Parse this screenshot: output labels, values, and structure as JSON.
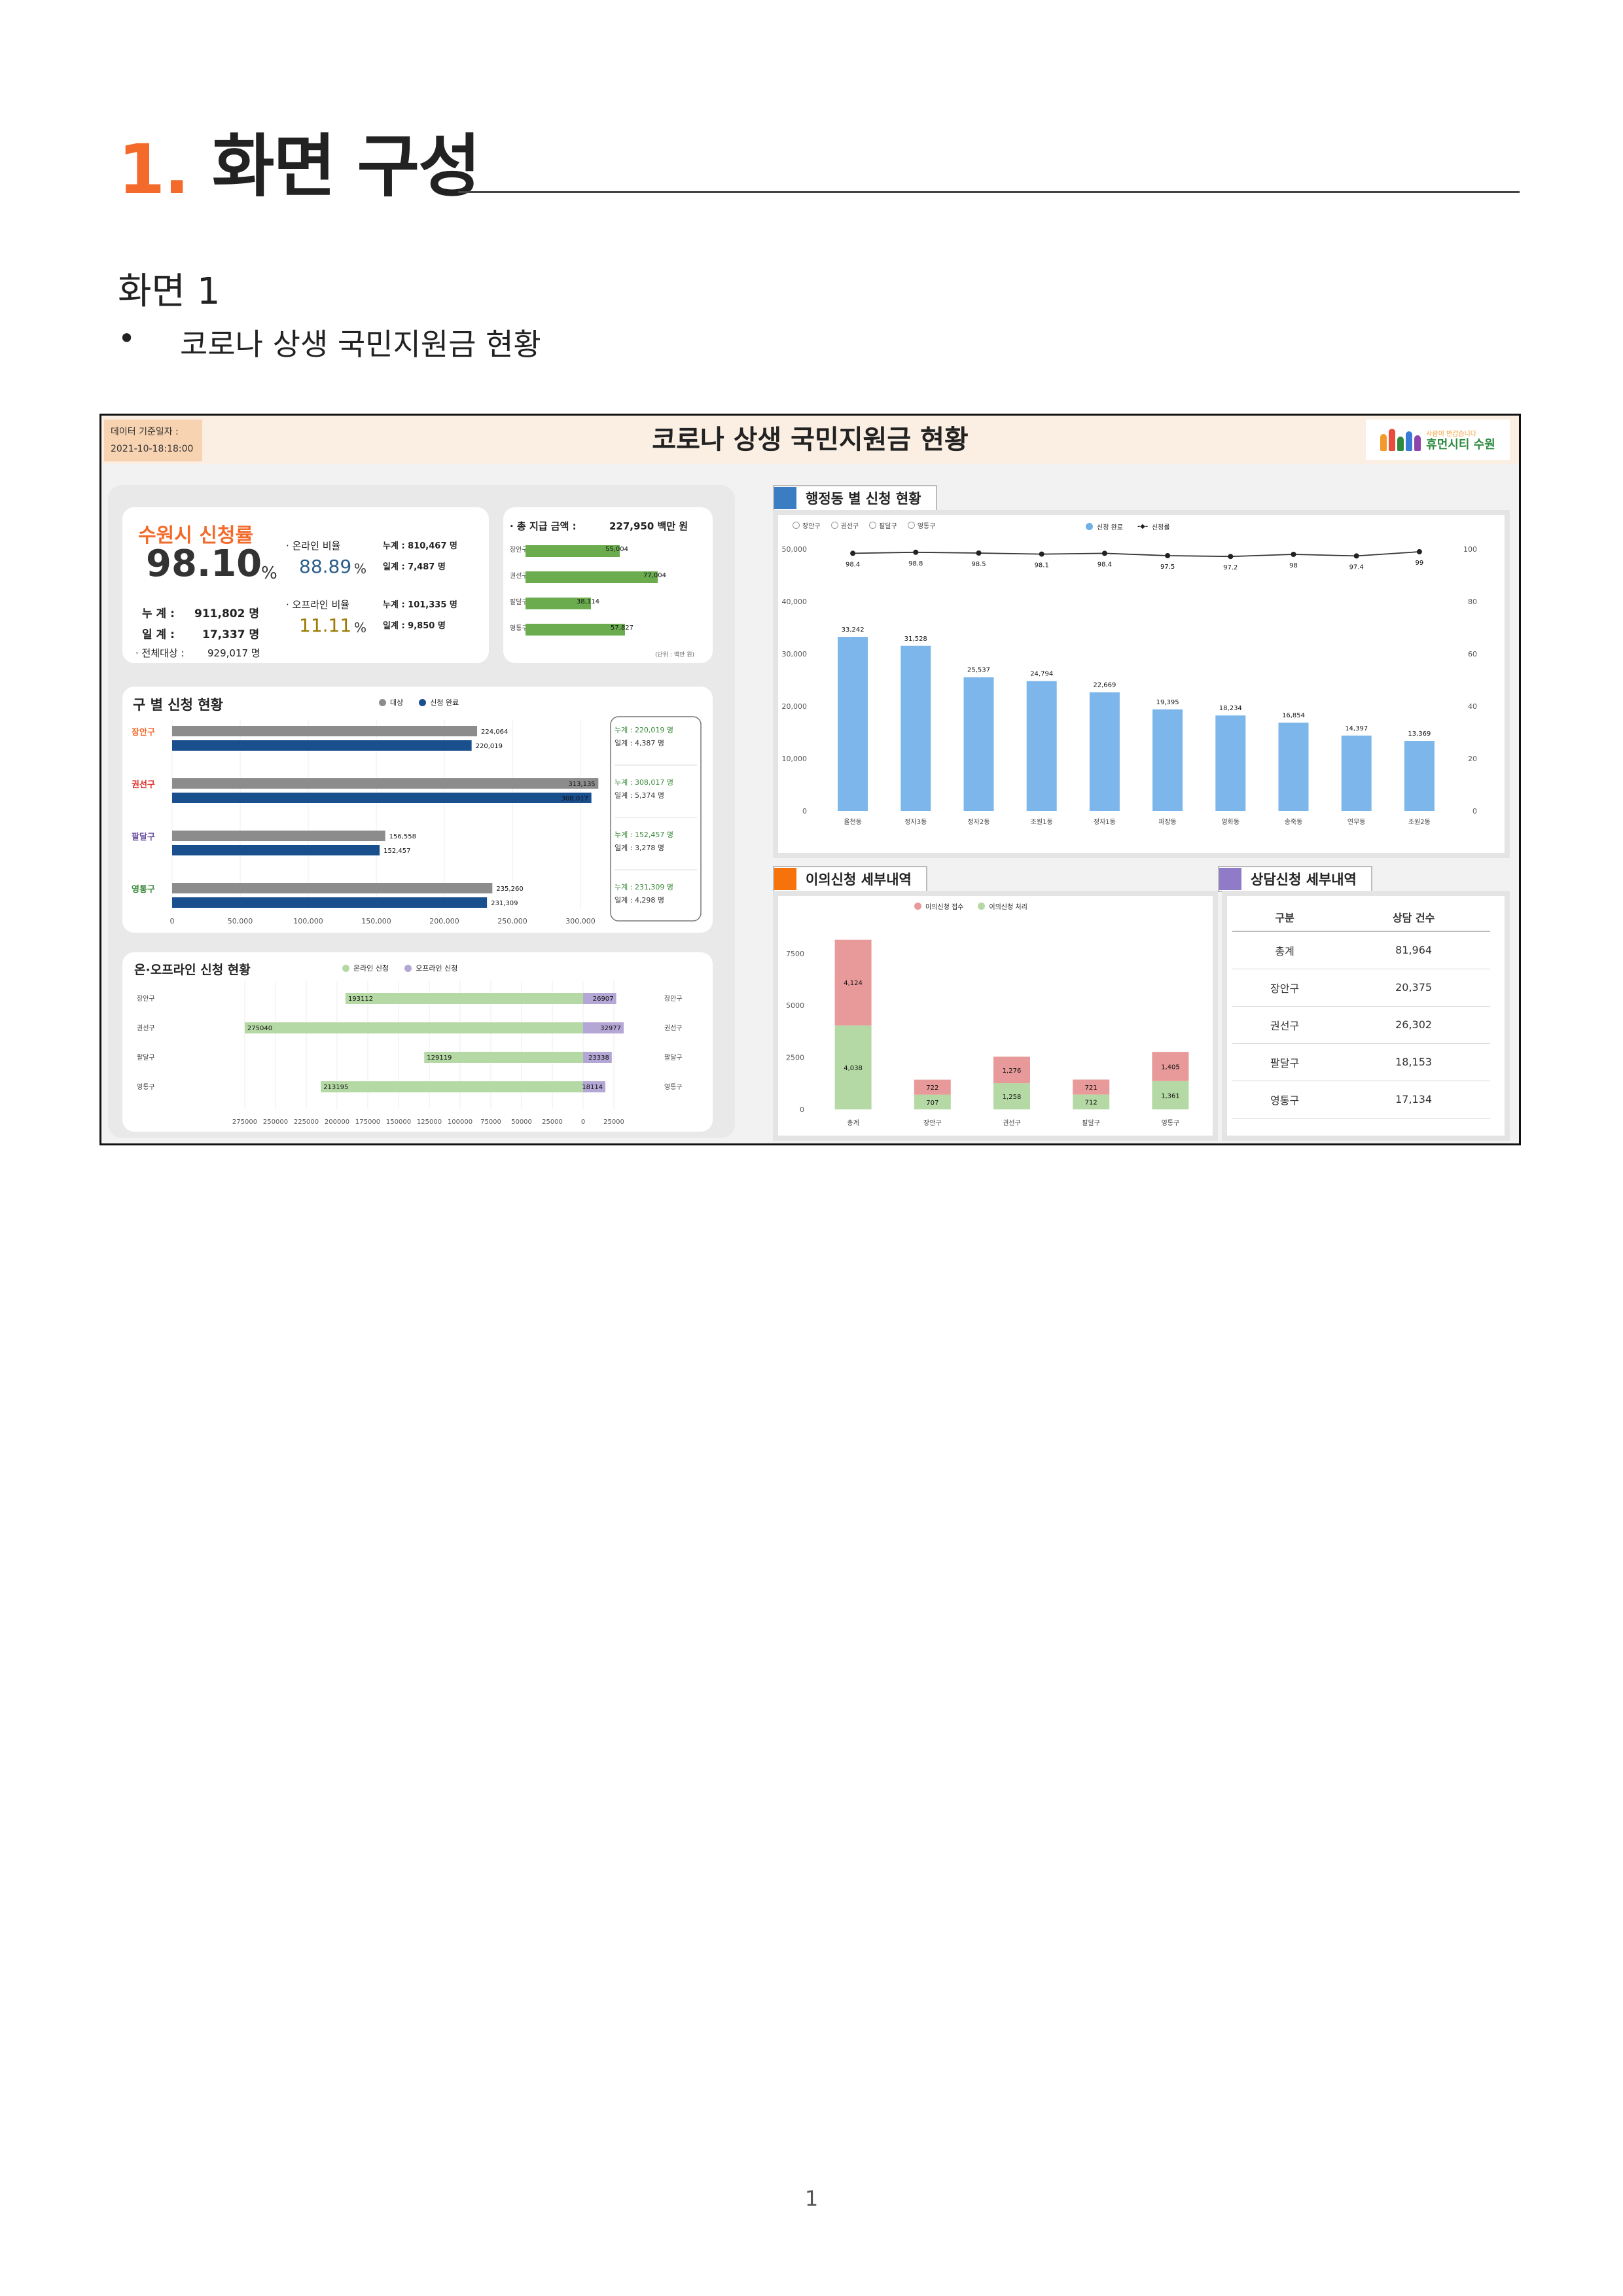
{
  "doc": {
    "title_number": "1.",
    "title": "화면 구성",
    "subtitle": "화면 1",
    "bullet_mark": "•",
    "bullet_text": "코로나 상생 국민지원금 현황",
    "page_number": "1"
  },
  "dashboard": {
    "date_label": "데이터 기준일자 :",
    "date_value": "2021-10-18:18:00",
    "title": "코로나 상생 국민지원금 현황",
    "logo_small": "사람이 반갑습니다",
    "logo_main": "휴먼시티 수원",
    "rate_card": {
      "title": "수원시 신청률",
      "rate": "98.10",
      "rate_unit": "%",
      "cum_label": "누  계 :",
      "cum_value": "911,802 명",
      "day_label": "일  계 :",
      "day_value": "17,337 명",
      "total_label": "· 전체대상 :",
      "total_value": "929,017 명",
      "online_label": "· 온라인 비율",
      "online_rate": "88.89",
      "online_cum": "누계 :  810,467 명",
      "online_day": "일계 :    7,487 명",
      "offline_label": "· 오프라인 비율",
      "offline_rate": "11.11",
      "offline_cum": "누계 :  101,335 명",
      "offline_day": "일계 :    9,850 명",
      "pct": "%"
    },
    "pay_card": {
      "title": "· 총 지급 금액 :",
      "amount": "227,950 백만 원",
      "unit_note": "(단위 : 백만 원)",
      "rows": [
        {
          "name": "장안구",
          "value": 55004,
          "label": "55,004"
        },
        {
          "name": "권선구",
          "value": 77004,
          "label": "77,004"
        },
        {
          "name": "팔달구",
          "value": 38114,
          "label": "38,114"
        },
        {
          "name": "영통구",
          "value": 57827,
          "label": "57,827"
        }
      ]
    },
    "gu_card": {
      "title": "구 별 신청 현황",
      "legend_target": "대상",
      "legend_done": "신청 완료",
      "axis_ticks": [
        "0",
        "50,000",
        "100,000",
        "150,000",
        "200,000",
        "250,000",
        "300,000"
      ],
      "rows": [
        {
          "name": "장안구",
          "color": "#f36a2b",
          "target": 224064,
          "target_label": "224,064",
          "done": 220019,
          "done_label": "220,019",
          "cum": "누계 :  220,019 명",
          "day": "일계 :     4,387 명"
        },
        {
          "name": "권선구",
          "color": "#e0302b",
          "target": 313135,
          "target_label": "313,135",
          "done": 308017,
          "done_label": "308,017",
          "cum": "누계 :  308,017 명",
          "day": "일계 :     5,374 명"
        },
        {
          "name": "팔달구",
          "color": "#6b4ea2",
          "target": 156558,
          "target_label": "156,558",
          "done": 152457,
          "done_label": "152,457",
          "cum": "누계 :  152,457 명",
          "day": "일계 :     3,278 명"
        },
        {
          "name": "영통구",
          "color": "#3d8a3d",
          "target": 235260,
          "target_label": "235,260",
          "done": 231309,
          "done_label": "231,309",
          "cum": "누계 :  231,309 명",
          "day": "일계 :     4,298 명"
        }
      ]
    },
    "onoff_card": {
      "title": "온·오프라인 신청 현황",
      "legend_online": "온라인 신청",
      "legend_offline": "오프라인 신청",
      "axis_ticks": [
        "275000",
        "250000",
        "225000",
        "200000",
        "175000",
        "150000",
        "125000",
        "100000",
        "75000",
        "50000",
        "25000",
        "0",
        "25000"
      ],
      "rows": [
        {
          "name": "장안구",
          "online": 193112,
          "offline": 26907
        },
        {
          "name": "권선구",
          "online": 275040,
          "offline": 32977
        },
        {
          "name": "팔달구",
          "online": 129119,
          "offline": 23338
        },
        {
          "name": "영통구",
          "online": 213195,
          "offline": 18114
        }
      ]
    },
    "dong_section": {
      "title": "행정동 별 신청 현황",
      "filters": [
        "장안구",
        "권선구",
        "팔달구",
        "영통구"
      ],
      "legend_bar": "신청 완료",
      "legend_line": "신청률"
    },
    "objection_section": {
      "title": "이의신청 세부내역",
      "legend_received": "이의신청 접수",
      "legend_processed": "이의신청 처리"
    },
    "consult_section": {
      "title": "상담신청 세부내역",
      "headers": [
        "구분",
        "상담 건수"
      ],
      "rows": [
        [
          "총계",
          "81,964"
        ],
        [
          "장안구",
          "20,375"
        ],
        [
          "권선구",
          "26,302"
        ],
        [
          "팔달구",
          "18,153"
        ],
        [
          "영통구",
          "17,134"
        ]
      ]
    }
  },
  "chart_data": [
    {
      "type": "bar",
      "title": "행정동 별 신청 현황",
      "categories": [
        "율천동",
        "정자3동",
        "정자2동",
        "조원1동",
        "정자1동",
        "파장동",
        "영화동",
        "송죽동",
        "연무동",
        "조원2동"
      ],
      "series": [
        {
          "name": "신청 완료",
          "values": [
            33242,
            31528,
            25537,
            24794,
            22669,
            19395,
            18234,
            16854,
            14397,
            13369
          ]
        },
        {
          "name": "신청률",
          "type": "line",
          "axis": "right",
          "values": [
            98.4,
            98.8,
            98.5,
            98.1,
            98.4,
            97.5,
            97.2,
            98,
            97.4,
            99
          ]
        }
      ],
      "bar_labels": [
        "33,242",
        "31,528",
        "25,537",
        "24,794",
        "22,669",
        "19,395",
        "18,234",
        "16,854",
        "14,397",
        "13,369"
      ],
      "rate_labels": [
        "98.4",
        "98.8",
        "98.5",
        "98.1",
        "98.4",
        "97.5",
        "97.2",
        "98",
        "97.4",
        "99"
      ],
      "y_ticks": [
        "0",
        "10,000",
        "20,000",
        "30,000",
        "40,000",
        "50,000"
      ],
      "y2_ticks": [
        "0",
        "20",
        "40",
        "60",
        "80",
        "100"
      ],
      "ylim": [
        0,
        50000
      ],
      "y2lim": [
        0,
        100
      ],
      "grid": false,
      "legend": "top"
    },
    {
      "type": "bar",
      "stacked": true,
      "title": "이의신청 세부내역",
      "categories": [
        "총계",
        "장안구",
        "권선구",
        "팔달구",
        "영통구"
      ],
      "series": [
        {
          "name": "이의신청 처리",
          "values": [
            4038,
            707,
            1258,
            712,
            1361
          ]
        },
        {
          "name": "이의신청 접수",
          "values": [
            4124,
            722,
            1276,
            721,
            1405
          ]
        }
      ],
      "processed_labels": [
        "4,038",
        "707",
        "1,258",
        "712",
        "1,361"
      ],
      "received_labels": [
        "4,124",
        "722",
        "1,276",
        "721",
        "1,405"
      ],
      "y_ticks": [
        "0",
        "2500",
        "5000",
        "7500"
      ],
      "ylim": [
        0,
        8500
      ],
      "legend": "top"
    }
  ]
}
